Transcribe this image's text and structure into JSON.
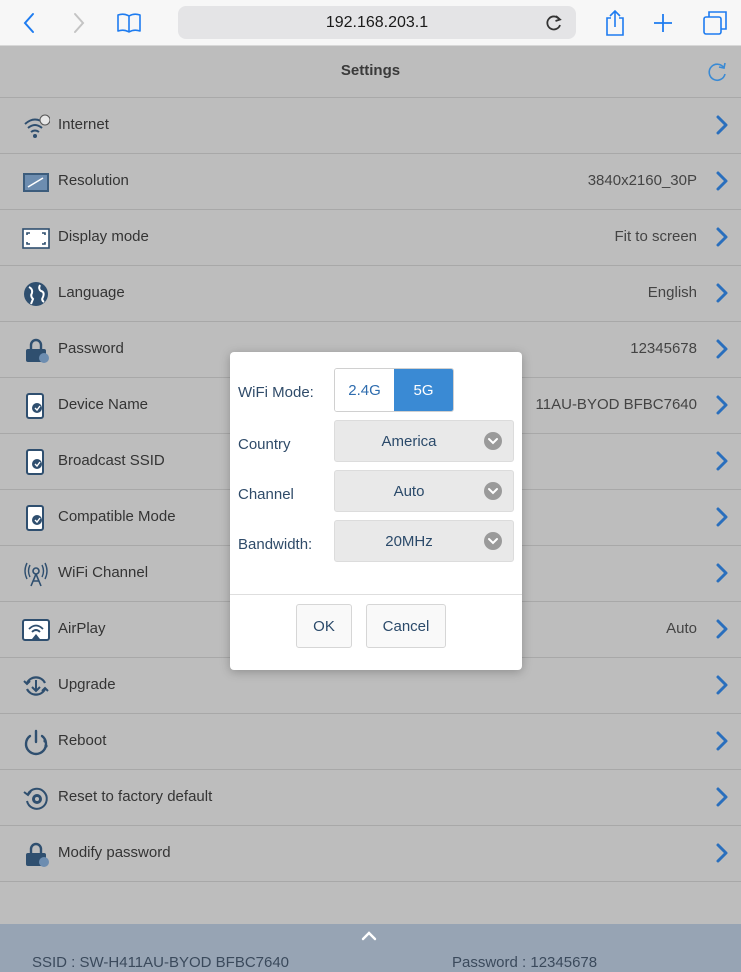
{
  "browser": {
    "url": "192.168.203.1"
  },
  "app": {
    "title": "Settings",
    "rows": [
      {
        "label": "Internet",
        "value": "",
        "icon": "wifi-globe-icon"
      },
      {
        "label": "Resolution",
        "value": "3840x2160_30P",
        "icon": "monitor-icon"
      },
      {
        "label": "Display mode",
        "value": "Fit to screen",
        "icon": "display-mode-icon"
      },
      {
        "label": "Language",
        "value": "English",
        "icon": "globe-icon"
      },
      {
        "label": "Password",
        "value": "12345678",
        "icon": "lock-icon"
      },
      {
        "label": "Device Name",
        "value": "11AU-BYOD BFBC7640",
        "icon": "device-icon"
      },
      {
        "label": "Broadcast SSID",
        "value": "",
        "icon": "device-icon"
      },
      {
        "label": "Compatible Mode",
        "value": "",
        "icon": "device-icon"
      },
      {
        "label": "WiFi Channel",
        "value": "",
        "icon": "antenna-icon"
      },
      {
        "label": "AirPlay",
        "value": "Auto",
        "icon": "airplay-icon"
      },
      {
        "label": "Upgrade",
        "value": "",
        "icon": "upgrade-icon"
      },
      {
        "label": "Reboot",
        "value": "",
        "icon": "power-icon"
      },
      {
        "label": "Reset to factory default",
        "value": "",
        "icon": "reset-icon"
      },
      {
        "label": "Modify password",
        "value": "",
        "icon": "lock-icon"
      }
    ],
    "footer": {
      "ssid": "SSID : SW-H411AU-BYOD BFBC7640",
      "password": "Password : 12345678"
    }
  },
  "dialog": {
    "wifi_mode_label": "WiFi Mode:",
    "wifi_mode_options": [
      "2.4G",
      "5G"
    ],
    "wifi_mode_selected": "5G",
    "country_label": "Country",
    "country_value": "America",
    "channel_label": "Channel",
    "channel_value": "Auto",
    "bandwidth_label": "Bandwidth:",
    "bandwidth_value": "20MHz",
    "ok_label": "OK",
    "cancel_label": "Cancel"
  },
  "colors": {
    "accent": "#3a8ad4",
    "browser_accent": "#1e7cf0",
    "chevron": "#2a6fbd"
  }
}
